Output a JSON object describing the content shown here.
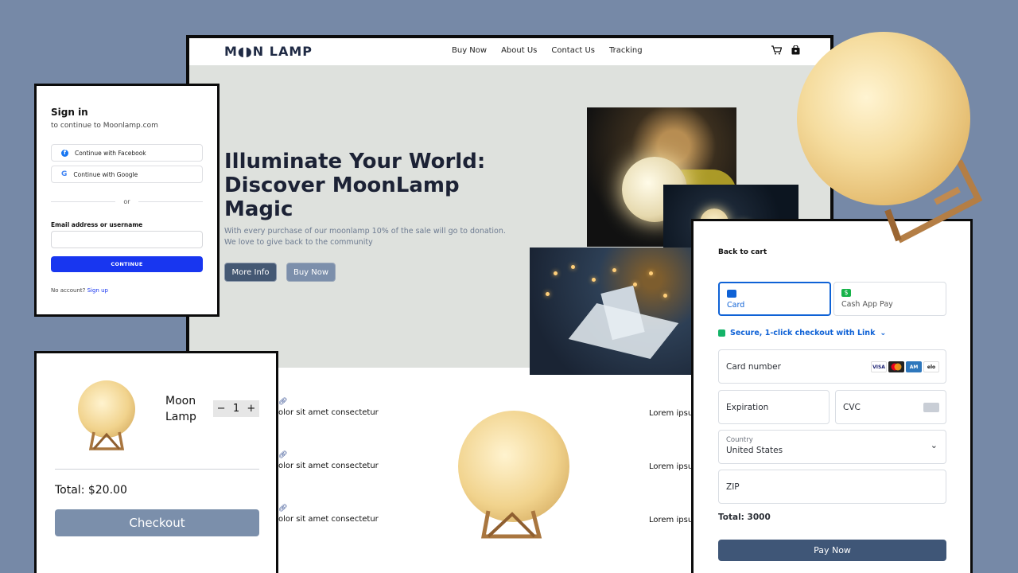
{
  "site": {
    "logo": "M◖◗N LAMP",
    "nav": [
      "Buy Now",
      "About Us",
      "Contact Us",
      "Tracking"
    ],
    "hero_title": "Illuminate Your World: Discover MoonLamp Magic",
    "hero_sub": "With every purchase of our moonlamp 10% of the sale will go to donation. We love to give back to the community",
    "more_info": "More Info",
    "buy_now": "Buy Now",
    "features_left": [
      "olor sit amet consectetur",
      "olor sit amet consectetur",
      "olor sit amet consectetur"
    ],
    "features_right": [
      "Lorem ipsu",
      "Lorem ipsu",
      "Lorem ipsu"
    ]
  },
  "signin": {
    "title": "Sign in",
    "subtitle": "to continue to Moonlamp.com",
    "facebook": "Continue with Facebook",
    "google": "Continue with Google",
    "or": "or",
    "email_label": "Email address or username",
    "continue": "CONTINUE",
    "no_account": "No account?",
    "sign_up": "Sign up"
  },
  "cart": {
    "product": "Moon Lamp",
    "quantity": "1",
    "total": "Total: $20.00",
    "checkout": "Checkout"
  },
  "payment": {
    "back": "Back to cart",
    "tab_card": "Card",
    "tab_cash": "Cash App Pay",
    "link": "Secure, 1-click checkout with Link",
    "card_number": "Card number",
    "expiration": "Expiration",
    "cvc": "CVC",
    "country_label": "Country",
    "country_value": "United States",
    "zip": "ZIP",
    "total": "Total: 3000",
    "pay_now": "Pay Now"
  },
  "colors": {
    "background": "#7689a7",
    "accent_blue": "#1836f0",
    "pay_blue": "#0f62d6",
    "button_slate": "#7b8fab"
  }
}
